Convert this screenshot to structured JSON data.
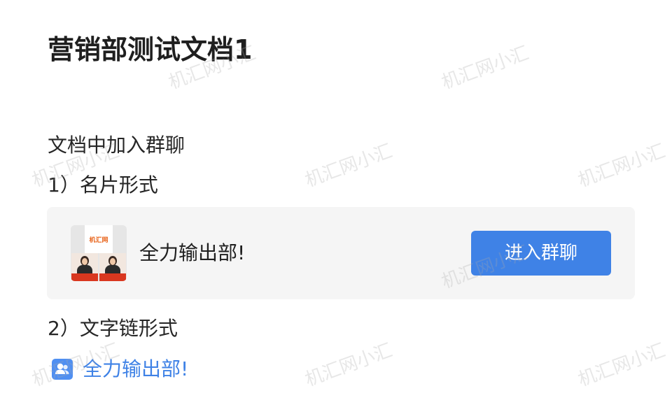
{
  "document": {
    "title": "营销部测试文档1",
    "intro": "文档中加入群聊",
    "section1_label": "1）名片形式",
    "section2_label": "2）文字链形式"
  },
  "group_card": {
    "avatar_logo_text": "机汇网",
    "name": "全力输出部!",
    "join_button": "进入群聊"
  },
  "text_link": {
    "icon": "group-chat-icon",
    "label": "全力输出部!"
  },
  "watermark": {
    "text": "机汇网小汇"
  },
  "colors": {
    "accent": "#3f82e6",
    "card_bg": "#f5f5f5",
    "logo_orange": "#e8641b"
  }
}
